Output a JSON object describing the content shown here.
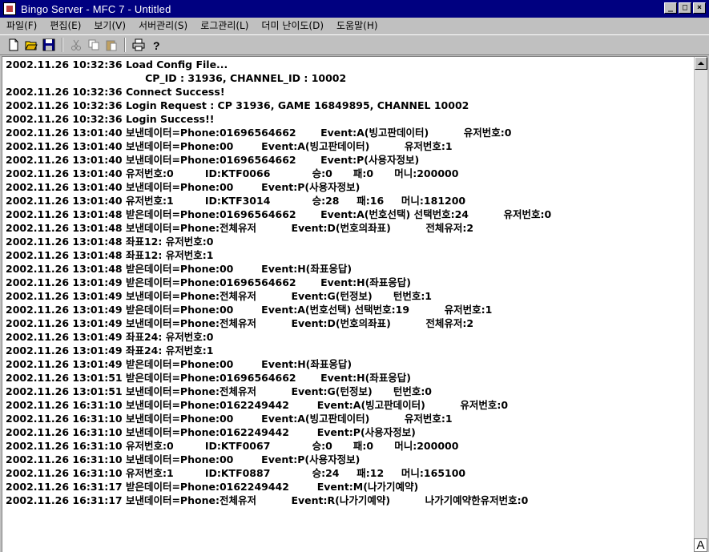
{
  "window": {
    "title": "Bingo Server - MFC 7 - Untitled",
    "controls": [
      "_",
      "□",
      "×"
    ]
  },
  "menubar": {
    "items": [
      {
        "label": "파일(F)"
      },
      {
        "label": "편집(E)"
      },
      {
        "label": "보기(V)"
      },
      {
        "label": "서버관리(S)"
      },
      {
        "label": "로그관리(L)"
      },
      {
        "label": "더미 난이도(D)"
      },
      {
        "label": "도움말(H)"
      }
    ]
  },
  "toolbar": {
    "icons": [
      "new-file-icon",
      "open-folder-icon",
      "save-icon",
      "cut-icon",
      "copy-icon",
      "paste-icon",
      "print-icon",
      "help-icon"
    ]
  },
  "log": {
    "lines": [
      "2002.11.26 10:32:36 Load Config File...",
      "                                        CP_ID : 31936, CHANNEL_ID : 10002",
      "2002.11.26 10:32:36 Connect Success!",
      "2002.11.26 10:32:36 Login Request : CP 31936, GAME 16849895, CHANNEL 10002",
      "2002.11.26 10:32:36 Login Success!!",
      "2002.11.26 13:01:40 보낸데이터=Phone:01696564662       Event:A(빙고판데이터)          유저번호:0",
      "2002.11.26 13:01:40 보낸데이터=Phone:00        Event:A(빙고판데이터)          유저번호:1",
      "2002.11.26 13:01:40 보낸데이터=Phone:01696564662       Event:P(사용자정보)",
      "2002.11.26 13:01:40 유저번호:0         ID:KTF0066            승:0      패:0      머니:200000",
      "2002.11.26 13:01:40 보낸데이터=Phone:00        Event:P(사용자정보)",
      "2002.11.26 13:01:40 유저번호:1         ID:KTF3014            승:28     패:16     머니:181200",
      "2002.11.26 13:01:48 받은데이터=Phone:01696564662       Event:A(번호선택) 선택번호:24          유저번호:0",
      "2002.11.26 13:01:48 보낸데이터=Phone:전체유저          Event:D(번호의좌표)          전체유저:2",
      "2002.11.26 13:01:48 좌표12: 유저번호:0",
      "2002.11.26 13:01:48 좌표12: 유저번호:1",
      "2002.11.26 13:01:48 받은데이터=Phone:00        Event:H(좌표응답)",
      "2002.11.26 13:01:49 받은데이터=Phone:01696564662       Event:H(좌표응답)",
      "2002.11.26 13:01:49 보낸데이터=Phone:전체유저          Event:G(턴정보)      턴번호:1",
      "2002.11.26 13:01:49 받은데이터=Phone:00        Event:A(번호선택) 선택번호:19          유저번호:1",
      "2002.11.26 13:01:49 보낸데이터=Phone:전체유저          Event:D(번호의좌표)          전체유저:2",
      "2002.11.26 13:01:49 좌표24: 유저번호:0",
      "2002.11.26 13:01:49 좌표24: 유저번호:1",
      "2002.11.26 13:01:49 받은데이터=Phone:00        Event:H(좌표응답)",
      "2002.11.26 13:01:51 받은데이터=Phone:01696564662       Event:H(좌표응답)",
      "2002.11.26 13:01:51 보낸데이터=Phone:전체유저          Event:G(턴정보)      턴번호:0",
      "2002.11.26 16:31:10 보낸데이터=Phone:0162249442        Event:A(빙고판데이터)          유저번호:0",
      "2002.11.26 16:31:10 보낸데이터=Phone:00        Event:A(빙고판데이터)          유저번호:1",
      "2002.11.26 16:31:10 보낸데이터=Phone:0162249442        Event:P(사용자정보)",
      "2002.11.26 16:31:10 유저번호:0         ID:KTF0067            승:0      패:0      머니:200000",
      "2002.11.26 16:31:10 보낸데이터=Phone:00        Event:P(사용자정보)",
      "2002.11.26 16:31:10 유저번호:1         ID:KTF0887            승:24     패:12     머니:165100",
      "2002.11.26 16:31:17 받은데이터=Phone:0162249442        Event:M(나가기예약)",
      "2002.11.26 16:31:17 보낸데이터=Phone:전체유저          Event:R(나가기예약)          나가기예약한유저번호:0"
    ]
  },
  "corner": {
    "glyph": "A"
  }
}
